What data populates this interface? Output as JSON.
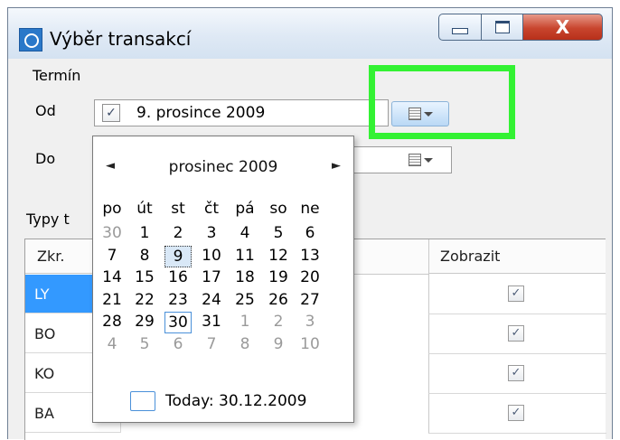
{
  "window": {
    "title": "Výběr transakcí",
    "icon": "app-calendar-icon",
    "controls": {
      "minimize_icon": "minimize-icon",
      "maximize_icon": "maximize-icon",
      "close_glyph": "X"
    }
  },
  "group_termin": {
    "label": "Termín",
    "od": {
      "label": "Od",
      "checked": true,
      "check_glyph": "✓",
      "value": "9. prosince  2009"
    },
    "do": {
      "label": "Do"
    }
  },
  "group_typy": {
    "label": "Typy t"
  },
  "grid": {
    "columns": [
      "Zkr.",
      "Zobrazit"
    ],
    "rows": [
      {
        "code": "LY",
        "check_glyph": "✓",
        "selected": true
      },
      {
        "code": "BO",
        "check_glyph": "✓",
        "selected": false
      },
      {
        "code": "KO",
        "check_glyph": "✓",
        "selected": false
      },
      {
        "code": "BA",
        "check_glyph": "✓",
        "selected": false
      }
    ]
  },
  "calendar": {
    "prev": "◄",
    "next": "►",
    "month_label": "prosinec 2009",
    "weekdays": [
      "po",
      "út",
      "st",
      "čt",
      "pá",
      "so",
      "ne"
    ],
    "weeks": [
      [
        "30",
        "1",
        "2",
        "3",
        "4",
        "5",
        "6"
      ],
      [
        "7",
        "8",
        "9",
        "10",
        "11",
        "12",
        "13"
      ],
      [
        "14",
        "15",
        "16",
        "17",
        "18",
        "19",
        "20"
      ],
      [
        "21",
        "22",
        "23",
        "24",
        "25",
        "26",
        "27"
      ],
      [
        "28",
        "29",
        "30",
        "31",
        "1",
        "2",
        "3"
      ],
      [
        "4",
        "5",
        "6",
        "7",
        "8",
        "9",
        "10"
      ]
    ],
    "selected_day": "9",
    "today_day": "30",
    "today_label": "Today: 30.12.2009"
  },
  "colors": {
    "highlight": "#33f233",
    "selection": "#3399ff",
    "titlebar": "#dfe9f5",
    "close_button": "#c8452e"
  }
}
